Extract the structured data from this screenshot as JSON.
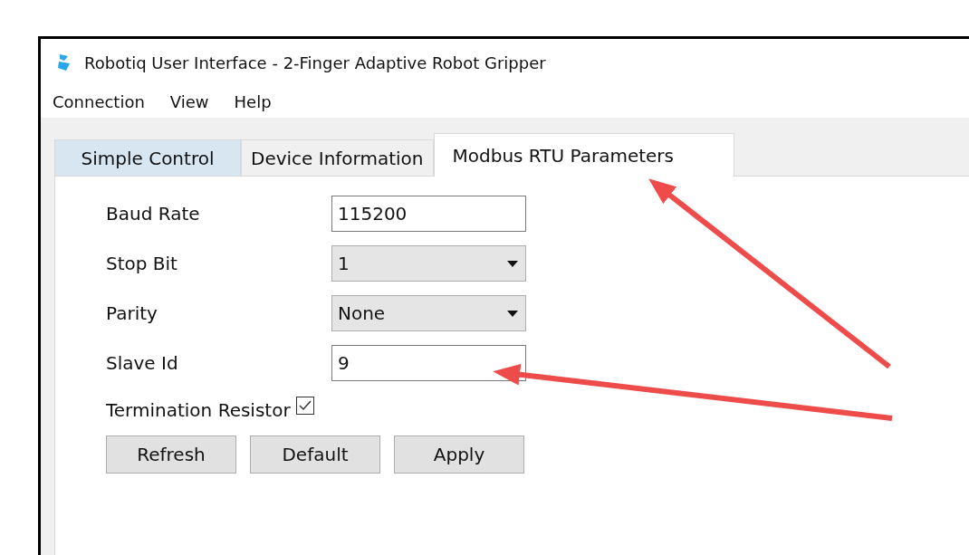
{
  "window": {
    "title": "Robotiq User Interface - 2-Finger Adaptive Robot Gripper"
  },
  "menu": [
    "Connection",
    "View",
    "Help"
  ],
  "tabs": [
    {
      "label": "Simple Control",
      "selected": false,
      "hover": true
    },
    {
      "label": "Device Information",
      "selected": false,
      "hover": false
    },
    {
      "label": "Modbus RTU Parameters",
      "selected": true,
      "hover": false
    }
  ],
  "fields": [
    {
      "label": "Baud Rate",
      "kind": "text",
      "value": "115200"
    },
    {
      "label": "Stop Bit",
      "kind": "combo",
      "value": "1"
    },
    {
      "label": "Parity",
      "kind": "combo",
      "value": "None"
    },
    {
      "label": "Slave Id",
      "kind": "text",
      "value": "9"
    }
  ],
  "termination": {
    "label": "Termination Resistor",
    "checked": true
  },
  "buttons": [
    "Refresh",
    "Default",
    "Apply"
  ]
}
